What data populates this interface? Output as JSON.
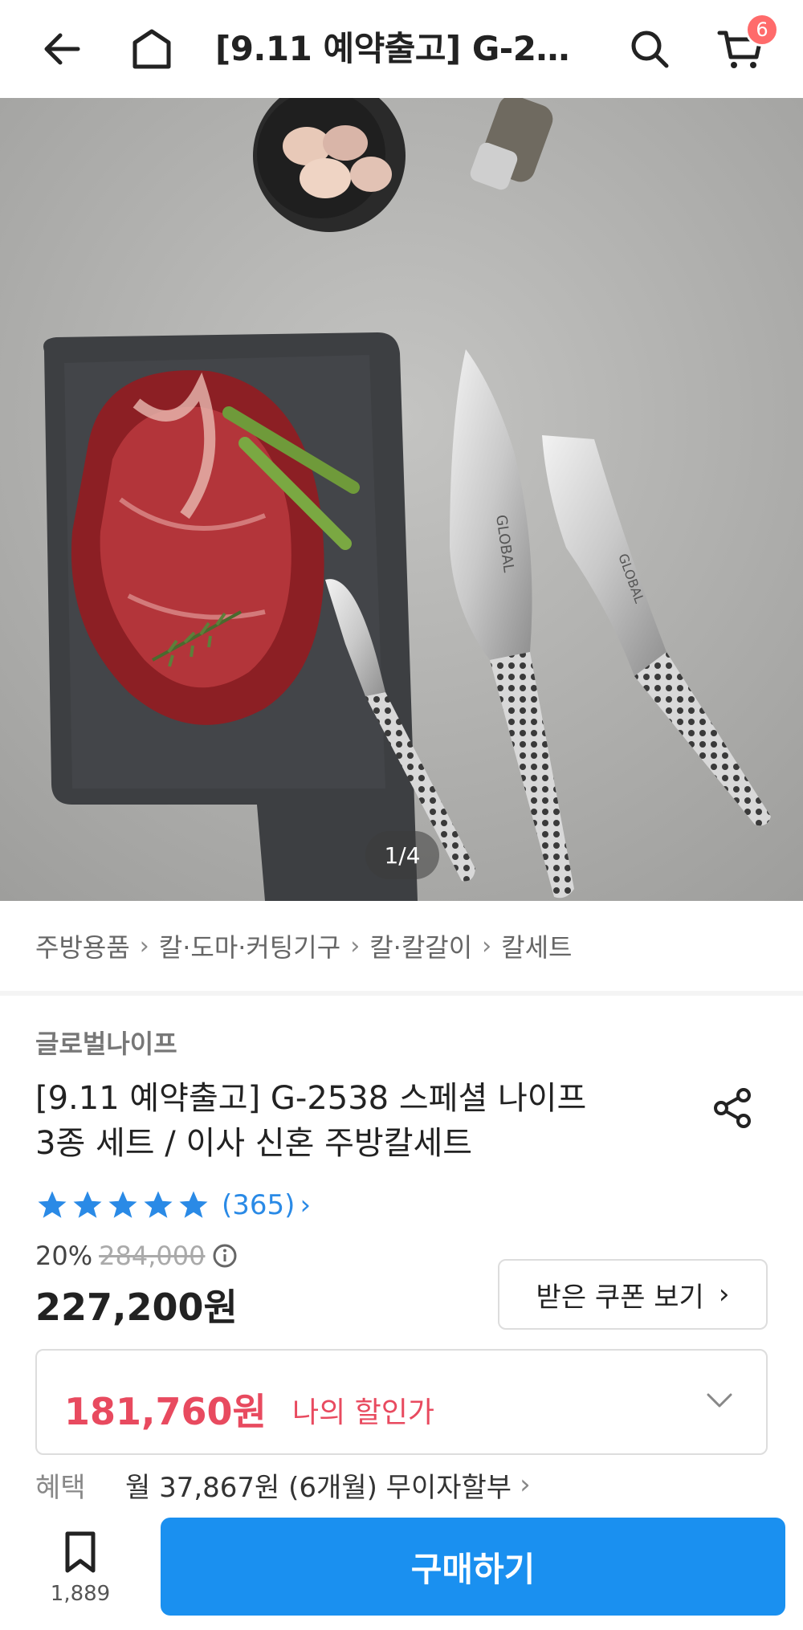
{
  "header": {
    "title": "[9.11 예약출고] G-25...",
    "cart_count": "6"
  },
  "hero": {
    "image_counter": "1/4",
    "knife_brand": "GLOBAL"
  },
  "breadcrumb": [
    "주방용품",
    "칼·도마·커팅기구",
    "칼·칼갈이",
    "칼세트"
  ],
  "product": {
    "brand": "글로벌나이프",
    "title_line1": "[9.11 예약출고] G-2538 스페셜 나이프",
    "title_line2": "3종 세트 / 이사 신혼 주방칼세트",
    "rating_stars": 5,
    "review_count": "(365)",
    "discount_rate": "20%",
    "original_price": "284,000",
    "sale_price": "227,200원",
    "coupon_button": "받은 쿠폰 보기",
    "my_price": "181,760원",
    "my_price_label": "나의 할인가",
    "benefit_label": "혜택",
    "benefit_text": "월 37,867원 (6개월) 무이자할부"
  },
  "bottom_bar": {
    "bookmark_count": "1,889",
    "buy_label": "구매하기"
  },
  "colors": {
    "accent_blue": "#1a90f0",
    "star_blue": "#2a8ae6",
    "discount_red": "#e84a5f",
    "badge_red": "#ff6b6b"
  }
}
